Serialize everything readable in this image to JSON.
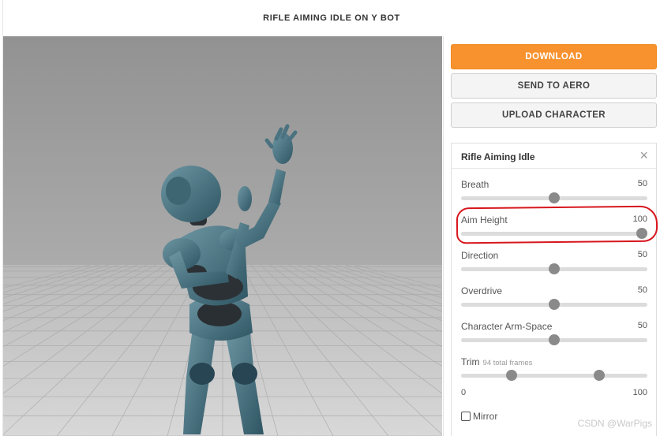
{
  "header": {
    "title": "RIFLE AIMING IDLE ON Y BOT"
  },
  "actions": {
    "download": "DOWNLOAD",
    "send_to_aero": "SEND TO AERO",
    "upload_character": "UPLOAD CHARACTER"
  },
  "animation_panel": {
    "title": "Rifle Aiming Idle",
    "close_icon": "close-icon",
    "params": [
      {
        "label": "Breath",
        "value": "50",
        "min": 0,
        "max": 100
      },
      {
        "label": "Aim Height",
        "value": "100",
        "min": 0,
        "max": 100
      },
      {
        "label": "Direction",
        "value": "50",
        "min": 0,
        "max": 100
      },
      {
        "label": "Overdrive",
        "value": "50",
        "min": 0,
        "max": 100
      },
      {
        "label": "Character Arm-Space",
        "value": "50",
        "min": 0,
        "max": 100
      }
    ],
    "trim": {
      "label": "Trim",
      "sublabel": "94 total frames",
      "start": 0,
      "end": 100,
      "min_label": "0",
      "max_label": "100",
      "handle_start_fraction": 0.27,
      "handle_end_fraction": 0.74
    },
    "mirror": {
      "label": "Mirror",
      "checked": false
    }
  },
  "annotation": {
    "color": "#d7161d"
  },
  "watermark": "CSDN @WarPigs",
  "colors": {
    "accent": "#f7922e",
    "character": "#4c7482",
    "viewport_bg": "#9a9a9a"
  }
}
